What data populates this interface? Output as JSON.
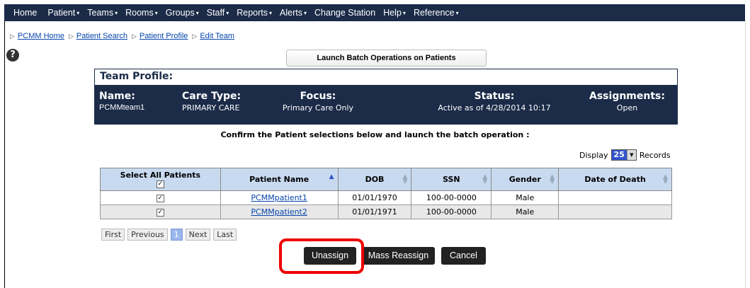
{
  "nav": {
    "items": [
      {
        "label": "Home",
        "dropdown": false
      },
      {
        "label": "Patient",
        "dropdown": true
      },
      {
        "label": "Teams",
        "dropdown": true
      },
      {
        "label": "Rooms",
        "dropdown": true
      },
      {
        "label": "Groups",
        "dropdown": true
      },
      {
        "label": "Staff",
        "dropdown": true
      },
      {
        "label": "Reports",
        "dropdown": true
      },
      {
        "label": "Alerts",
        "dropdown": true
      },
      {
        "label": "Change Station",
        "dropdown": false
      },
      {
        "label": "Help",
        "dropdown": true
      },
      {
        "label": "Reference",
        "dropdown": true
      }
    ]
  },
  "breadcrumb": [
    "PCMM Home",
    "Patient Search",
    "Patient Profile",
    "Edit Team"
  ],
  "launch_button": "Launch Batch Operations on Patients",
  "team_profile": {
    "title": "Team Profile:",
    "name_label": "Name:",
    "name_value": "PCMMteam1",
    "care_type_label": "Care Type:",
    "care_type_value": "PRIMARY CARE",
    "focus_label": "Focus:",
    "focus_value": "Primary Care Only",
    "status_label": "Status:",
    "status_value": "Active as of 4/28/2014 10:17",
    "assignments_label": "Assignments:",
    "assignments_value": "Open"
  },
  "confirm_text": "Confirm the Patient selections below and launch the batch operation :",
  "display": {
    "prefix": "Display",
    "value": "25",
    "suffix": "Records"
  },
  "table": {
    "headers": {
      "select_all": "Select All Patients",
      "patient_name": "Patient Name",
      "dob": "DOB",
      "ssn": "SSN",
      "gender": "Gender",
      "date_of_death": "Date of Death"
    },
    "rows": [
      {
        "checked": "✓",
        "name": "PCMMpatient1",
        "dob": "01/01/1970",
        "ssn": "100-00-0000",
        "gender": "Male",
        "dod": ""
      },
      {
        "checked": "✓",
        "name": "PCMMpatient2",
        "dob": "01/01/1971",
        "ssn": "100-00-0000",
        "gender": "Male",
        "dod": ""
      }
    ]
  },
  "pager": {
    "first": "First",
    "previous": "Previous",
    "current": "1",
    "next": "Next",
    "last": "Last"
  },
  "actions": {
    "unassign": "Unassign",
    "mass_reassign": "Mass Reassign",
    "cancel": "Cancel"
  },
  "colors": {
    "nav_bg": "#1b2b48",
    "header_bg": "#c8daf0",
    "highlight": "#e00000"
  }
}
